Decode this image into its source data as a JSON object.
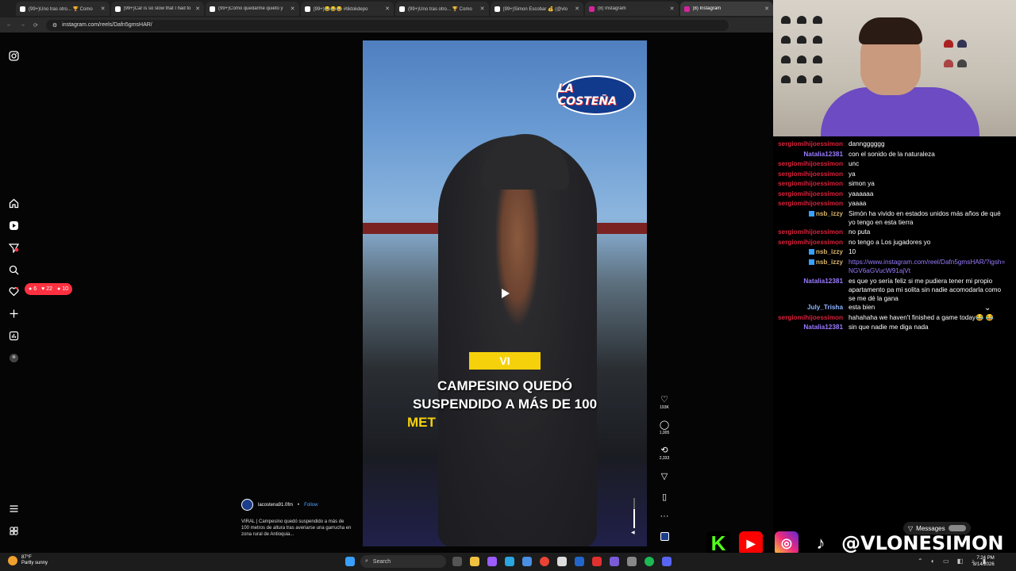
{
  "browser": {
    "tabs": [
      {
        "label": "(99+)Uno tras otro... 🏆 Como"
      },
      {
        "label": "(99+)Car is so slow that I had to"
      },
      {
        "label": "(99+)Cómo quedarme quieto y"
      },
      {
        "label": "(99+)😂😂😂 #tiktokdepo"
      },
      {
        "label": "(99+)Uno tras otro... 🏆 Como"
      },
      {
        "label": "(99+)Simon Escobar 💰 (@vlo"
      },
      {
        "label": "(8) Instagram"
      },
      {
        "label": "(8) Instagram"
      }
    ],
    "url": "instagram.com/reels/Dafn5gmsHAR/"
  },
  "instagram": {
    "notifications": {
      "comments": "6",
      "likes": "22",
      "follows": "10"
    },
    "reel": {
      "logo_text": "LA COSTEÑA",
      "overlay_highlight": "VI",
      "overlay_line1": "CAMPESINO QUEDÓ",
      "overlay_line2": "SUSPENDIDO A MÁS DE 100",
      "overlay_line3": "MET",
      "likes": "193K",
      "comments": "1,005",
      "reposts": "2,333",
      "author": "lacostena91.0fm",
      "separator": "•",
      "follow": "Follow",
      "description": "VIRAL | Campesino quedó suspendido a más de 100 metros de altura tras averiarse una garrucha en zona rural de Antioquia..."
    },
    "icons": {
      "instagram": "instagram-icon",
      "home": "home-icon",
      "reels": "reels-icon",
      "send": "send-icon",
      "search": "search-icon",
      "heart": "heart-icon",
      "create": "plus-icon",
      "insights": "chart-icon",
      "profile": "profile-icon",
      "menu": "menu-icon",
      "meta": "meta-icon"
    }
  },
  "chat": {
    "messages": [
      {
        "user": "sergiomihijoessimon",
        "text": "danngggggg",
        "color": "red"
      },
      {
        "user": "Natalia12381",
        "text": "con el sonido de la naturaleza",
        "color": "purple"
      },
      {
        "user": "sergiomihijoessimon",
        "text": "unc",
        "color": "red"
      },
      {
        "user": "sergiomihijoessimon",
        "text": "ya",
        "color": "red"
      },
      {
        "user": "sergiomihijoessimon",
        "text": "simon ya",
        "color": "red"
      },
      {
        "user": "sergiomihijoessimon",
        "text": "yaaaaaa",
        "color": "red"
      },
      {
        "user": "sergiomihijoessimon",
        "text": "yaaaa",
        "color": "red"
      },
      {
        "user": "nsb_izzy",
        "text": "Simón ha vivido en estados unidos más años de qué yo tengo en esta tierra",
        "color": "gold",
        "badge": true
      },
      {
        "user": "sergiomihijoessimon",
        "text": "no puta",
        "color": "red"
      },
      {
        "user": "sergiomihijoessimon",
        "text": "no tengo a Los jugadores yo",
        "color": "red"
      },
      {
        "user": "nsb_izzy",
        "text": "10",
        "color": "gold",
        "badge": true
      },
      {
        "user": "nsb_izzy",
        "text": "https://www.instagram.com/reel/Dafn5gmsHAR/?igsh=NGV6aGVucW91ajVt",
        "color": "gold",
        "badge": true,
        "link": true
      },
      {
        "user": "Natalia12381",
        "text": "es que yo sería feliz si me pudiera tener mi propio apartamento pa mi solita sin nadie acomodarla como se me dé la gana",
        "color": "purple"
      },
      {
        "user": "July_Trisha",
        "text": "esta bien",
        "color": "blue"
      },
      {
        "user": "sergiomihijoessimon",
        "text": "hahahaha we haven't finished a game today😂 😂",
        "color": "red"
      },
      {
        "user": "Natalia12381",
        "text": "sin que nadie me diga nada",
        "color": "purple"
      }
    ]
  },
  "overlay": {
    "handle": "@VLONESIMON",
    "messages_label": "Messages"
  },
  "taskbar": {
    "temperature": "87°F",
    "weather": "Partly sunny",
    "search": "Search",
    "time": "7:24 PM",
    "date": "8/14/2026"
  }
}
